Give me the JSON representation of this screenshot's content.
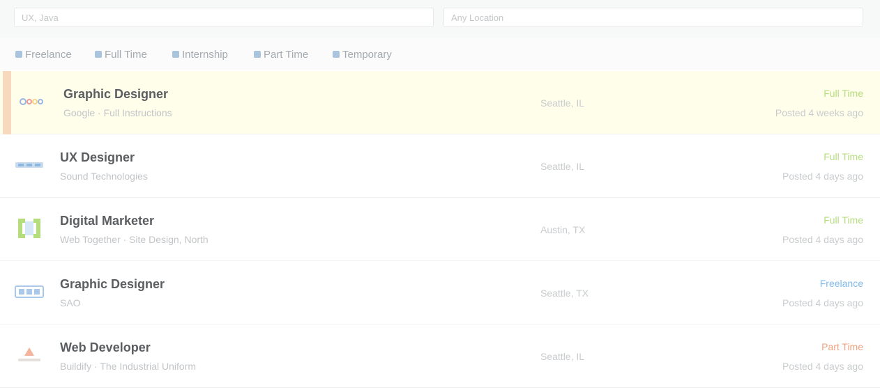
{
  "search": {
    "keywords_placeholder": "UX, Java",
    "location_placeholder": "Any Location"
  },
  "filters": [
    {
      "label": "Freelance"
    },
    {
      "label": "Full Time"
    },
    {
      "label": "Internship"
    },
    {
      "label": "Part Time"
    },
    {
      "label": "Temporary"
    }
  ],
  "jobs": [
    {
      "title": "Graphic Designer",
      "company": "Google · Full Instructions",
      "location": "Seattle, IL",
      "type": "Full Time",
      "type_color": "#b6dd7d",
      "posted": "Posted 4 weeks ago",
      "highlighted": true,
      "logo": "google-logo"
    },
    {
      "title": "UX Designer",
      "company": "Sound Technologies",
      "location": "Seattle, IL",
      "type": "Full Time",
      "type_color": "#b6dd7d",
      "posted": "Posted 4 days ago",
      "highlighted": false,
      "logo": "shield-logo"
    },
    {
      "title": "Digital Marketer",
      "company": "Web Together · Site Design, North",
      "location": "Austin, TX",
      "type": "Full Time",
      "type_color": "#b6dd7d",
      "posted": "Posted 4 days ago",
      "highlighted": false,
      "logo": "frame-logo"
    },
    {
      "title": "Graphic Designer",
      "company": "SAO",
      "location": "Seattle, TX",
      "type": "Freelance",
      "type_color": "#7ebbec",
      "posted": "Posted 4 days ago",
      "highlighted": false,
      "logo": "sao-logo"
    },
    {
      "title": "Web Developer",
      "company": "Buildify · The Industrial Uniform",
      "location": "Seattle, IL",
      "type": "Part Time",
      "type_color": "#f0a27f",
      "posted": "Posted 4 days ago",
      "highlighted": false,
      "logo": "triangle-logo"
    }
  ]
}
